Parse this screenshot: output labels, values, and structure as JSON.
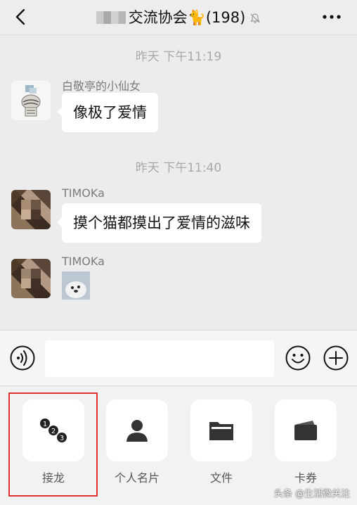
{
  "header": {
    "title": "交流协会🐈(198)",
    "back_icon": "chevron-left-icon",
    "mute_icon": "bell-off-icon",
    "more_icon": "more-icon"
  },
  "messages": {
    "time1": "昨天 下午11:19",
    "msg1": {
      "sender": "白敬亭的小仙女",
      "text": "像极了爱情"
    },
    "time2": "昨天 下午11:40",
    "msg2": {
      "sender": "TIMOKa",
      "text": "摸个猫都摸出了爱情的滋味"
    },
    "msg3": {
      "sender": "TIMOKa",
      "content": "sticker-image"
    }
  },
  "input": {
    "value": "",
    "placeholder": "",
    "voice_icon": "voice-icon",
    "emoji_icon": "emoji-icon",
    "plus_icon": "plus-icon"
  },
  "tools": [
    {
      "label": "接龙",
      "icon": "solitaire-icon"
    },
    {
      "label": "个人名片",
      "icon": "contact-card-icon"
    },
    {
      "label": "文件",
      "icon": "folder-icon"
    },
    {
      "label": "卡券",
      "icon": "wallet-icon"
    }
  ],
  "highlight_color": "#e0302b",
  "watermark": "头条 @生活微关注"
}
